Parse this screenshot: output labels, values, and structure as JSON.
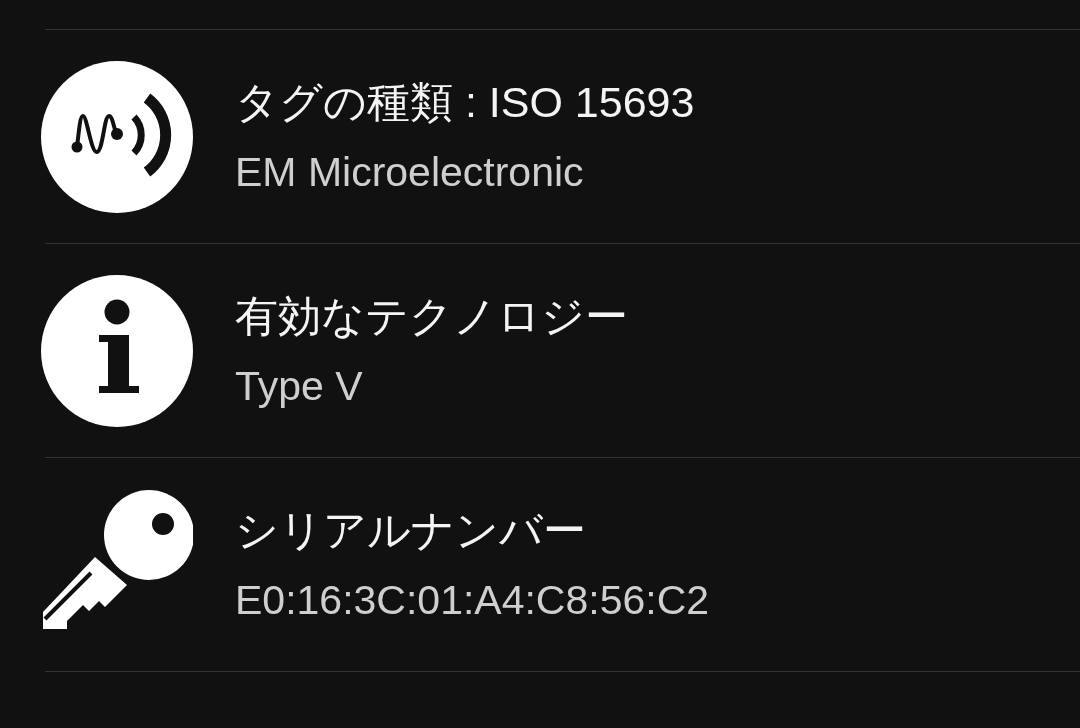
{
  "rows": [
    {
      "kind": "tag",
      "title": "タグの種類 : ISO 15693",
      "value": "EM Microelectronic"
    },
    {
      "kind": "technology",
      "title": "有効なテクノロジー",
      "value": "Type V"
    },
    {
      "kind": "serial",
      "title": "シリアルナンバー",
      "value": "E0:16:3C:01:A4:C8:56:C2"
    }
  ]
}
